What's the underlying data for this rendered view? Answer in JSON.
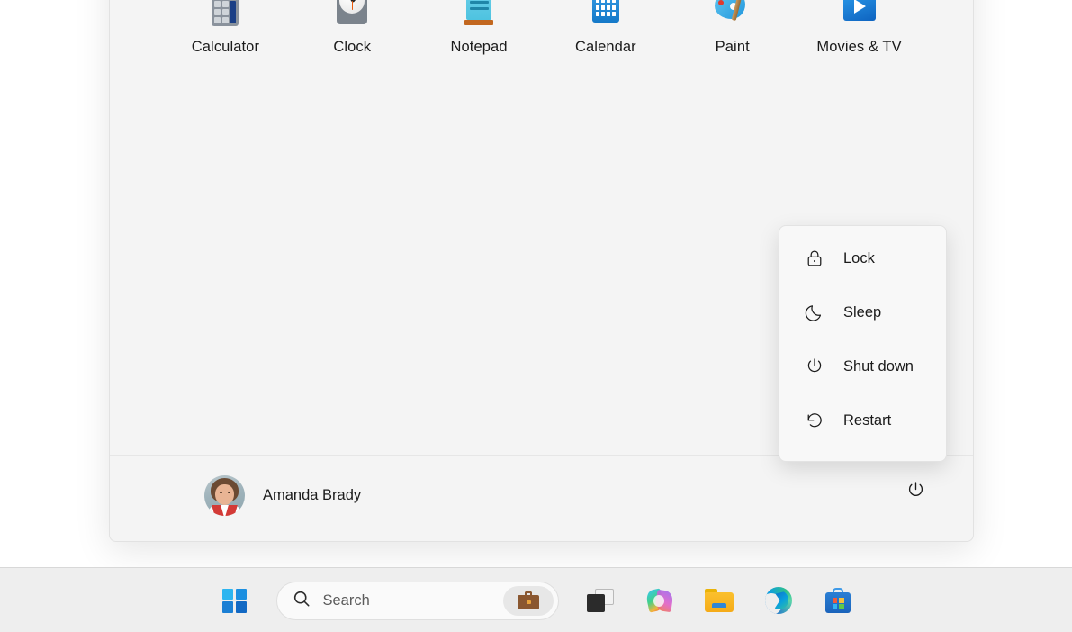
{
  "start_menu": {
    "pinned_apps": [
      {
        "label": "Calculator",
        "icon": "calculator-icon"
      },
      {
        "label": "Clock",
        "icon": "clock-icon"
      },
      {
        "label": "Notepad",
        "icon": "notepad-icon"
      },
      {
        "label": "Calendar",
        "icon": "calendar-icon"
      },
      {
        "label": "Paint",
        "icon": "paint-icon"
      },
      {
        "label": "Movies & TV",
        "icon": "movies-and-tv-icon"
      }
    ],
    "footer": {
      "user_name": "Amanda Brady",
      "avatar": "user-avatar",
      "power_icon": "power-icon"
    }
  },
  "power_menu": {
    "items": [
      {
        "label": "Lock",
        "icon": "lock-icon"
      },
      {
        "label": "Sleep",
        "icon": "moon-icon"
      },
      {
        "label": "Shut down",
        "icon": "power-icon"
      },
      {
        "label": "Restart",
        "icon": "restart-icon"
      }
    ]
  },
  "taskbar": {
    "start_button": "windows-logo-icon",
    "search": {
      "placeholder": "Search",
      "value": "",
      "search_icon": "search-icon",
      "chip_icon": "briefcase-icon"
    },
    "buttons": [
      {
        "name": "task-view",
        "icon": "task-view-icon"
      },
      {
        "name": "copilot",
        "icon": "copilot-icon"
      },
      {
        "name": "file-explorer",
        "icon": "file-explorer-icon"
      },
      {
        "name": "microsoft-edge",
        "icon": "edge-icon"
      },
      {
        "name": "microsoft-store",
        "icon": "store-icon"
      }
    ]
  },
  "colors": {
    "panel_bg": "#f4f4f4",
    "taskbar_bg": "#eeeeee",
    "desktop_bg": "#ffffff",
    "text": "#1b1b1b",
    "accent": "#1c8fe0"
  }
}
